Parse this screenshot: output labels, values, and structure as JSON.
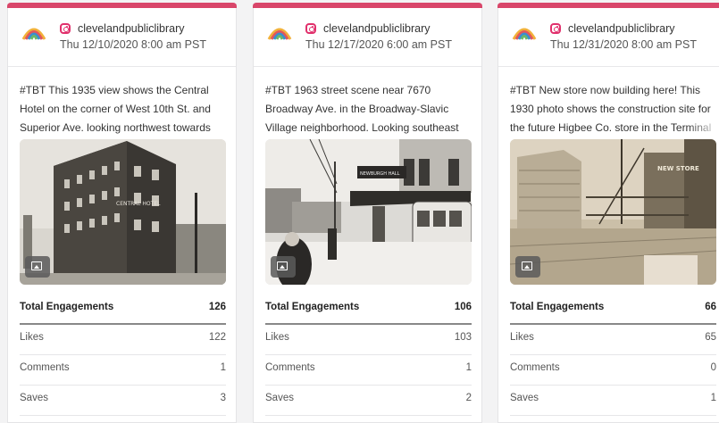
{
  "posts": [
    {
      "handle": "clevelandpubliclibrary",
      "date": "Thu 12/10/2020 8:00 am PST",
      "caption": "#TBT This 1935 view shows the Central Hotel on the corner of West 10th St. and Superior Ave. looking northwest towards the",
      "photo_sign": "CENTRAL HOTEL",
      "stats": {
        "total_label": "Total Engagements",
        "total": "126",
        "likes_label": "Likes",
        "likes": "122",
        "comments_label": "Comments",
        "comments": "1",
        "saves_label": "Saves",
        "saves": "3"
      }
    },
    {
      "handle": "clevelandpubliclibrary",
      "date": "Thu 12/17/2020 6:00 am PST",
      "caption": "#TBT 1963 street scene near 7670 Broadway Ave. in the Broadway-Slavic Village neighborhood. Looking southeast on",
      "photo_sign": "NEWBURGH HALL",
      "stats": {
        "total_label": "Total Engagements",
        "total": "106",
        "likes_label": "Likes",
        "likes": "103",
        "comments_label": "Comments",
        "comments": "1",
        "saves_label": "Saves",
        "saves": "2"
      }
    },
    {
      "handle": "clevelandpubliclibrary",
      "date": "Thu 12/31/2020 8:00 am PST",
      "caption": "#TBT New store now building here! This 1930 photo shows the construction site for the future Higbee Co. store in the Terminal Tow",
      "photo_sign": "NEW STORE",
      "stats": {
        "total_label": "Total Engagements",
        "total": "66",
        "likes_label": "Likes",
        "likes": "65",
        "comments_label": "Comments",
        "comments": "0",
        "saves_label": "Saves",
        "saves": "1"
      }
    }
  ],
  "colors": {
    "accent": "#d9466a",
    "instagram": "#e1306c"
  },
  "icons": {
    "account": "instagram-icon",
    "media": "image-icon",
    "brand": "library-logo-icon"
  }
}
